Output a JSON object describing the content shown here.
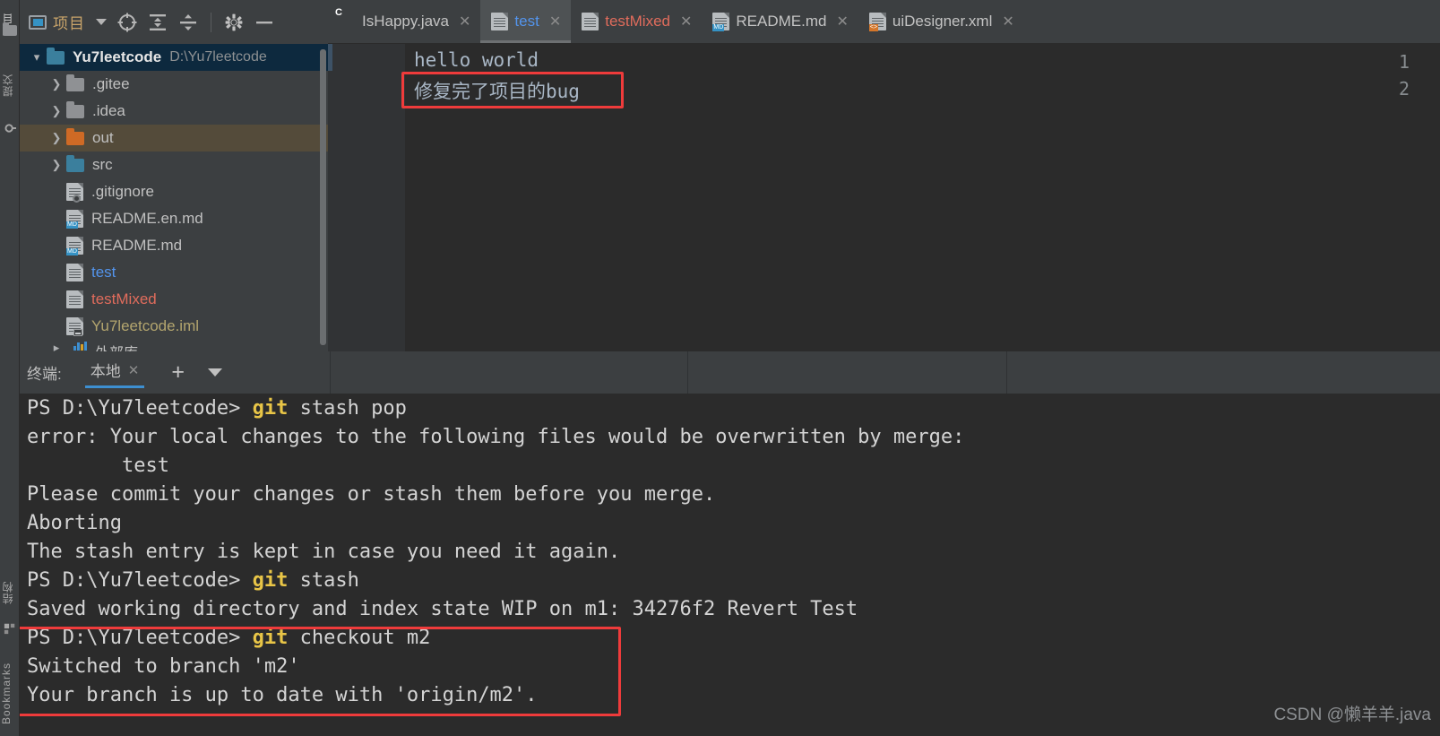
{
  "toolbar": {
    "project_label": "项目",
    "icons": [
      {
        "name": "locate-icon",
        "glyph": "locate"
      },
      {
        "name": "expand-all-icon",
        "glyph": "expand"
      },
      {
        "name": "collapse-all-icon",
        "glyph": "collapse"
      },
      {
        "name": "settings-gear-icon",
        "glyph": "gear"
      },
      {
        "name": "hide-panel-icon",
        "glyph": "minus"
      }
    ]
  },
  "left_strip": {
    "project_label": "项目",
    "commit_label": "提交",
    "structure_label": "结构",
    "bookmarks_label": "Bookmarks"
  },
  "tabs": [
    {
      "label": "IsHappy.java",
      "icon": "java-class-icon",
      "color": "plain",
      "active": false,
      "closable": true
    },
    {
      "label": "test",
      "icon": "text-file-icon",
      "color": "blue",
      "active": true,
      "closable": true
    },
    {
      "label": "testMixed",
      "icon": "text-file-icon",
      "color": "red",
      "active": false,
      "closable": true
    },
    {
      "label": "README.md",
      "icon": "markdown-file-icon",
      "color": "plain",
      "active": false,
      "closable": true
    },
    {
      "label": "uiDesigner.xml",
      "icon": "xml-file-icon",
      "color": "plain",
      "active": false,
      "closable": true
    }
  ],
  "tree": {
    "root": {
      "label": "Yu7leetcode",
      "path": "D:\\Yu7leetcode",
      "expanded": true
    },
    "items": [
      {
        "label": ".gitee",
        "kind": "folder",
        "folder_color": "gray",
        "arrow": ">",
        "color": "plain"
      },
      {
        "label": ".idea",
        "kind": "folder",
        "folder_color": "gray",
        "arrow": ">",
        "color": "plain"
      },
      {
        "label": "out",
        "kind": "folder",
        "folder_color": "orange",
        "arrow": ">",
        "color": "plain",
        "highlight": true
      },
      {
        "label": "src",
        "kind": "folder",
        "folder_color": "blue",
        "arrow": ">",
        "color": "plain"
      },
      {
        "label": ".gitignore",
        "kind": "ignored-file",
        "arrow": "",
        "color": "plain"
      },
      {
        "label": "README.en.md",
        "kind": "md-file",
        "arrow": "",
        "color": "plain"
      },
      {
        "label": "README.md",
        "kind": "md-file",
        "arrow": "",
        "color": "plain"
      },
      {
        "label": "test",
        "kind": "text-file",
        "arrow": "",
        "color": "blue"
      },
      {
        "label": "testMixed",
        "kind": "text-file",
        "arrow": "",
        "color": "red"
      },
      {
        "label": "Yu7leetcode.iml",
        "kind": "iml-file",
        "arrow": "",
        "color": "tan"
      }
    ],
    "cut_off_item": "外部库"
  },
  "editor": {
    "line_numbers": [
      "1",
      "2"
    ],
    "lines": [
      "hello world",
      "修复完了项目的bug"
    ],
    "highlight_line_index": 1
  },
  "terminal": {
    "title": "终端:",
    "tab_label": "本地",
    "add_label": "+",
    "lines": [
      {
        "prompt": "PS D:\\Yu7leetcode> ",
        "cmd": "git",
        "rest": " stash pop"
      },
      {
        "text": "error: Your local changes to the following files would be overwritten by merge:"
      },
      {
        "text": "        test"
      },
      {
        "text": "Please commit your changes or stash them before you merge."
      },
      {
        "text": "Aborting"
      },
      {
        "text": "The stash entry is kept in case you need it again."
      },
      {
        "prompt": "PS D:\\Yu7leetcode> ",
        "cmd": "git",
        "rest": " stash"
      },
      {
        "text": "Saved working directory and index state WIP on m1: 34276f2 Revert Test"
      },
      {
        "prompt": "PS D:\\Yu7leetcode> ",
        "cmd": "git",
        "rest": " checkout m2",
        "boxed": true
      },
      {
        "text": "Switched to branch 'm2'",
        "boxed": true
      },
      {
        "text": "Your branch is up to date with 'origin/m2'.",
        "boxed": true
      }
    ]
  },
  "watermark": "CSDN @懒羊羊.java",
  "colors": {
    "accent_blue": "#3d8fd1",
    "highlight_red": "#ef3b3b",
    "terminal_bg": "#2b2b2b",
    "panel_bg": "#3c3f41",
    "selection_blue": "#0d293e",
    "cmd_yellow": "#e8c547"
  }
}
